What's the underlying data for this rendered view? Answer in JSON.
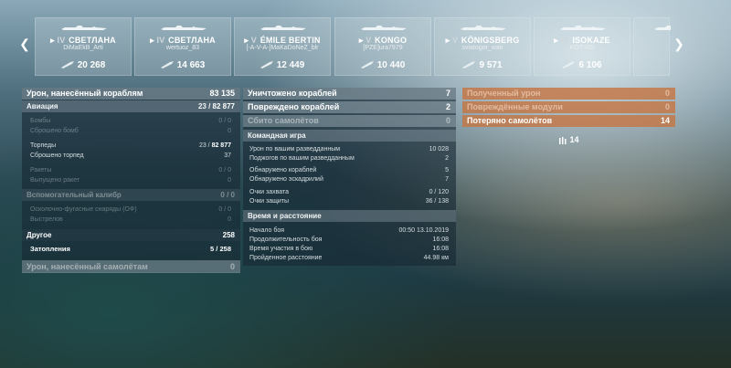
{
  "carousel": {
    "prev_icon": "chevron-left-icon",
    "next_icon": "chevron-right-icon",
    "ships": [
      {
        "tier": "IV",
        "name": "СВЕТЛАНА",
        "player": "DiMaEkB_Arti",
        "damage": "20 268"
      },
      {
        "tier": "IV",
        "name": "СВЕТЛАНА",
        "player": "wertuoz_83",
        "damage": "14 663"
      },
      {
        "tier": "V",
        "name": "ÉMILE BERTIN",
        "player": "[-A-V-A-]MaKaDoNeZ_blr",
        "damage": "12 449"
      },
      {
        "tier": "V",
        "name": "KONGO",
        "player": "[PZE]ura7979",
        "damage": "10 440"
      },
      {
        "tier": "V",
        "name": "KÖNIGSBERG",
        "player": "sviatogor_voin",
        "damage": "9 571"
      },
      {
        "tier": "IV",
        "name": "ISOKAZE",
        "player": "KOT-RD",
        "damage": "6 106"
      }
    ]
  },
  "left": {
    "header": {
      "label": "Урон, нанесённый кораблям",
      "value": "83 135"
    },
    "aviation": {
      "label": "Авиация",
      "value_a": "23",
      "value_b": "82 877"
    },
    "bombs": {
      "label": "Бомбы",
      "value": "0 / 0"
    },
    "bombs_dropped": {
      "label": "Сброшено бомб",
      "value": "0"
    },
    "torpedoes": {
      "label": "Торпеды",
      "value_a": "23",
      "value_b": "82 877"
    },
    "torpedoes_dropped": {
      "label": "Сброшено торпед",
      "value": "37"
    },
    "rockets": {
      "label": "Ракеты",
      "value": "0 / 0"
    },
    "rockets_fired": {
      "label": "Выпущено ракет",
      "value": "0"
    },
    "secondary": {
      "label": "Вспомогательный калибр",
      "value": "0 / 0"
    },
    "he_shells": {
      "label": "Осколочно-фугасные снаряды (ОФ)",
      "value": "0 / 0"
    },
    "shots": {
      "label": "Выстрелов",
      "value": "0"
    },
    "other": {
      "label": "Другое",
      "value": "258"
    },
    "flooding": {
      "label": "Затопления",
      "value_a": "5",
      "value_b": "258"
    },
    "planes_damage": {
      "label": "Урон, нанесённый самолётам",
      "value": "0"
    }
  },
  "middle": {
    "destroyed": {
      "label": "Уничтожено кораблей",
      "value": "7"
    },
    "damaged": {
      "label": "Повреждено кораблей",
      "value": "2"
    },
    "planes_shot": {
      "label": "Сбито самолётов",
      "value": "0"
    },
    "team_header": "Командная игра",
    "scout_damage": {
      "label": "Урон по вашим разведданным",
      "value": "10 028"
    },
    "scout_fires": {
      "label": "Поджогов по вашим разведданным",
      "value": "2"
    },
    "ships_spotted": {
      "label": "Обнаружено кораблей",
      "value": "5"
    },
    "squadrons_spotted": {
      "label": "Обнаружено эскадрилий",
      "value": "7"
    },
    "capture": {
      "label": "Очки захвата",
      "value": "0 / 120"
    },
    "defense": {
      "label": "Очки защиты",
      "value": "36 / 138"
    },
    "time_header": "Время и расстояние",
    "battle_start": {
      "label": "Начало боя",
      "value": "00:50  13.10.2019"
    },
    "battle_duration": {
      "label": "Продолжительность боя",
      "value": "16:08"
    },
    "participation": {
      "label": "Время участия в бою",
      "value": "16:08"
    },
    "distance": {
      "label": "Пройденное расстояние",
      "value": "44.98 км"
    }
  },
  "right": {
    "received": {
      "label": "Полученный урон",
      "value": "0"
    },
    "modules": {
      "label": "Повреждённые модули",
      "value": "0"
    },
    "planes_lost": {
      "label": "Потеряно самолётов",
      "value": "14"
    },
    "squadron_icon": "squadron-icon",
    "squadron_count": "14"
  },
  "colors": {
    "accent_orange": "#c47644",
    "header_blue": "#a8bac4"
  }
}
